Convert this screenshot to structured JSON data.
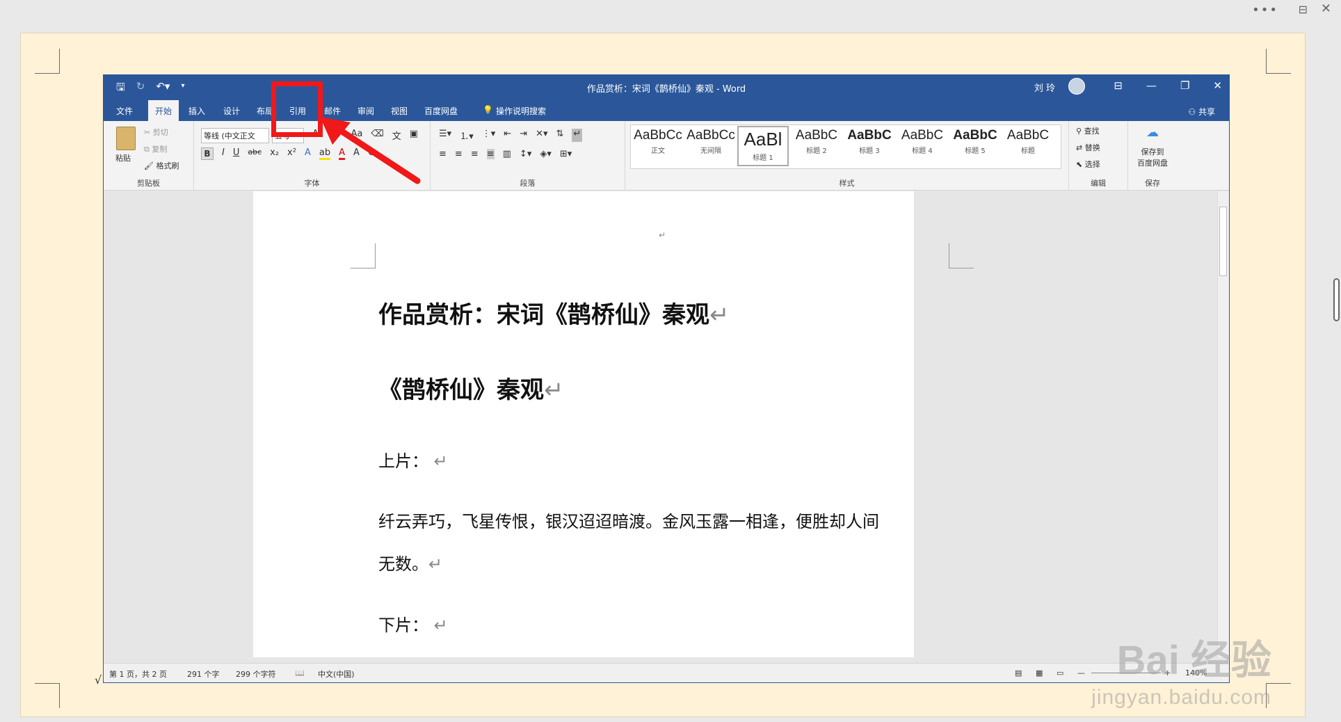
{
  "window": {
    "title": "作品赏析：宋词《鹊桥仙》秦观 - Word",
    "user": "刘 玲",
    "share": "共享"
  },
  "tabs": [
    "文件",
    "开始",
    "插入",
    "设计",
    "布局",
    "引用",
    "邮件",
    "审阅",
    "视图",
    "百度网盘"
  ],
  "search_hint": "操作说明搜索",
  "ribbon": {
    "clipboard": {
      "paste": "粘贴",
      "cut": "剪切",
      "copy": "复制",
      "painter": "格式刷",
      "label": "剪贴板"
    },
    "font": {
      "name": "等线 (中文正文",
      "size": "五号",
      "label": "字体"
    },
    "paragraph": {
      "label": "段落"
    },
    "styles": {
      "label": "样式",
      "items": [
        {
          "sample": "AaBbCc",
          "name": "正文"
        },
        {
          "sample": "AaBbCc",
          "name": "无间隔"
        },
        {
          "sample": "AaBl",
          "name": "标题 1"
        },
        {
          "sample": "AaBbC",
          "name": "标题 2"
        },
        {
          "sample": "AaBbC",
          "name": "标题 3"
        },
        {
          "sample": "AaBbC",
          "name": "标题 4"
        },
        {
          "sample": "AaBbC",
          "name": "标题 5"
        },
        {
          "sample": "AaBbC",
          "name": "标题"
        }
      ]
    },
    "editing": {
      "find": "查找",
      "replace": "替换",
      "select": "选择",
      "label": "编辑"
    },
    "save": {
      "line1": "保存到",
      "line2": "百度网盘",
      "label": "保存"
    }
  },
  "document": {
    "heading1": "作品赏析：宋词《鹊桥仙》秦观",
    "heading2": "《鹊桥仙》秦观",
    "section1": "上片：",
    "para1_line1": "纤云弄巧，飞星传恨，银汉迢迢暗渡。金风玉露一相逢，便胜却人间",
    "para1_line2": "无数。",
    "section2": "下片：",
    "para_mark": "↵"
  },
  "status": {
    "page": "第 1 页，共 2 页",
    "chars": "291 个字",
    "charcount": "299 个字符",
    "lang": "中文(中国)",
    "zoom": "140%"
  },
  "watermark": {
    "main": "Bai 经验",
    "sub": "jingyan.baidu.com"
  },
  "colors": {
    "titlebar": "#2b579a",
    "highlight": "#f01818",
    "outer_page": "#fff2d6"
  }
}
